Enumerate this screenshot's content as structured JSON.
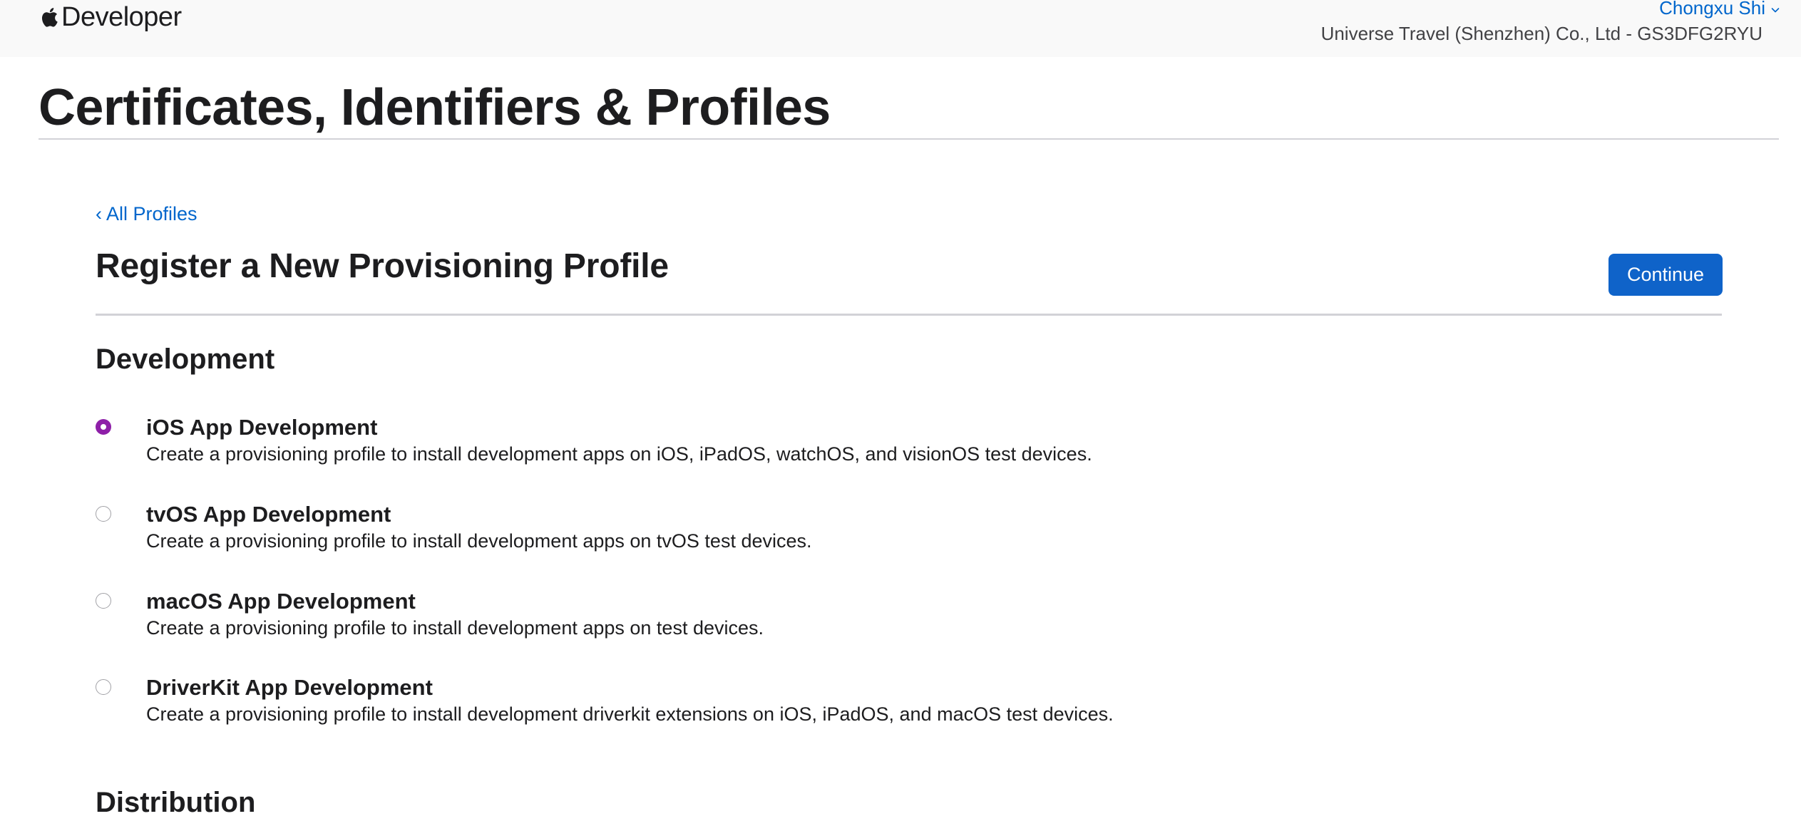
{
  "header": {
    "brand": "Developer",
    "user_name": "Chongxu Shi",
    "team": "Universe Travel (Shenzhen) Co., Ltd - GS3DFG2RYU"
  },
  "page": {
    "title": "Certificates, Identifiers & Profiles",
    "back_link": "‹ All Profiles",
    "section_title": "Register a New Provisioning Profile",
    "continue_label": "Continue"
  },
  "groups": {
    "development": {
      "title": "Development",
      "options": [
        {
          "title": "iOS App Development",
          "description": "Create a provisioning profile to install development apps on iOS, iPadOS, watchOS, and visionOS test devices.",
          "selected": true
        },
        {
          "title": "tvOS App Development",
          "description": "Create a provisioning profile to install development apps on tvOS test devices.",
          "selected": false
        },
        {
          "title": "macOS App Development",
          "description": "Create a provisioning profile to install development apps on test devices.",
          "selected": false
        },
        {
          "title": "DriverKit App Development",
          "description": "Create a provisioning profile to install development driverkit extensions on iOS, iPadOS, and macOS test devices.",
          "selected": false
        }
      ]
    },
    "distribution": {
      "title": "Distribution"
    }
  },
  "colors": {
    "link": "#0066cc",
    "button": "#0f63c9",
    "radio_selected": "#8e1fa8",
    "header_bg": "#f9f9f9"
  },
  "icons": {
    "brand": "apple-logo-icon",
    "user_menu": "chevron-down-icon"
  }
}
